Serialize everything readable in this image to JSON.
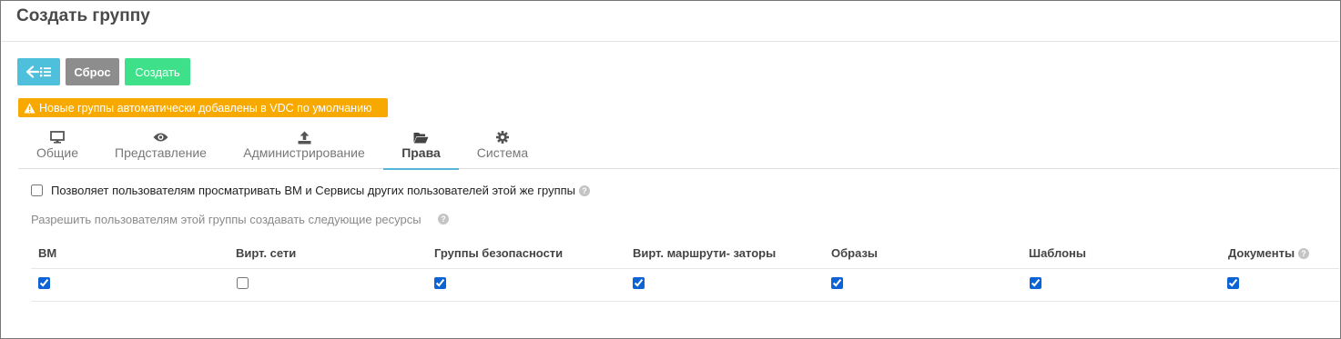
{
  "page_title": "Создать группу",
  "toolbar": {
    "back_icon": "arrow-left-list-icon",
    "reset_label": "Сброс",
    "create_label": "Создать"
  },
  "notice": {
    "icon": "warning-icon",
    "text": "Новые группы автоматически добавлены в VDC по умолчанию",
    "color": "#f7a900"
  },
  "tabs": [
    {
      "label": "Общие",
      "icon": "monitor-icon",
      "active": false
    },
    {
      "label": "Представление",
      "icon": "eye-icon",
      "active": false
    },
    {
      "label": "Администрирование",
      "icon": "upload-icon",
      "active": false
    },
    {
      "label": "Права",
      "icon": "folder-open-icon",
      "active": true
    },
    {
      "label": "Система",
      "icon": "gear-icon",
      "active": false
    }
  ],
  "permissions": {
    "view_others_label": "Позволяет пользователям просматривать ВМ и Сервисы других пользователей этой же группы",
    "view_others_checked": false,
    "allow_create_label": "Разрешить пользователям этой группы создавать следующие ресурсы"
  },
  "resources": {
    "columns": [
      "ВМ",
      "Вирт. сети",
      "Группы безопасности",
      "Вирт. маршрути- заторы",
      "Образы",
      "Шаблоны",
      "Документы"
    ],
    "checked": [
      true,
      false,
      true,
      true,
      true,
      true,
      true
    ]
  },
  "colors": {
    "accent": "#55b6d6",
    "back_button": "#4fc0db",
    "reset_button": "#8d8d8d",
    "create_button": "#3ee089"
  }
}
